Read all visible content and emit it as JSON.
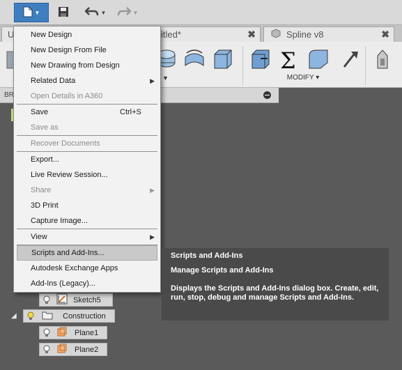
{
  "tabs": [
    {
      "label": "U"
    },
    {
      "label": "itled*"
    },
    {
      "label": "Spline v8"
    }
  ],
  "ribbon": {
    "modify_label": "MODIFY ▾"
  },
  "browser": {
    "title": "BR"
  },
  "file_menu": {
    "items": [
      {
        "label": "New Design"
      },
      {
        "label": "New Design From File"
      },
      {
        "label": "New Drawing from Design"
      },
      {
        "label": "Related Data"
      },
      {
        "label": "Open Details in A360"
      },
      {
        "label": "Save",
        "shortcut": "Ctrl+S"
      },
      {
        "label": "Save as"
      },
      {
        "label": "Recover Documents"
      },
      {
        "label": "Export..."
      },
      {
        "label": "Live Review Session..."
      },
      {
        "label": "Share"
      },
      {
        "label": "3D Print"
      },
      {
        "label": "Capture Image..."
      },
      {
        "label": "View"
      },
      {
        "label": "Scripts and Add-Ins..."
      },
      {
        "label": "Autodesk Exchange Apps"
      },
      {
        "label": "Add-Ins (Legacy)..."
      }
    ]
  },
  "tooltip": {
    "title": "Scripts and Add-Ins",
    "subtitle": "Manage Scripts and Add-Ins",
    "description": "Displays the Scripts and Add-Ins dialog box. Create, edit, run, stop, debug and manage Scripts and Add-Ins."
  },
  "tree": {
    "items": [
      {
        "label": "Sketch5"
      },
      {
        "label": "Construction"
      },
      {
        "label": "Plane1"
      },
      {
        "label": "Plane2"
      }
    ]
  },
  "colors": {
    "accent": "#3f7fc1",
    "bulb_on": "#f2d94a",
    "plane_orange": "#e08a3c"
  }
}
